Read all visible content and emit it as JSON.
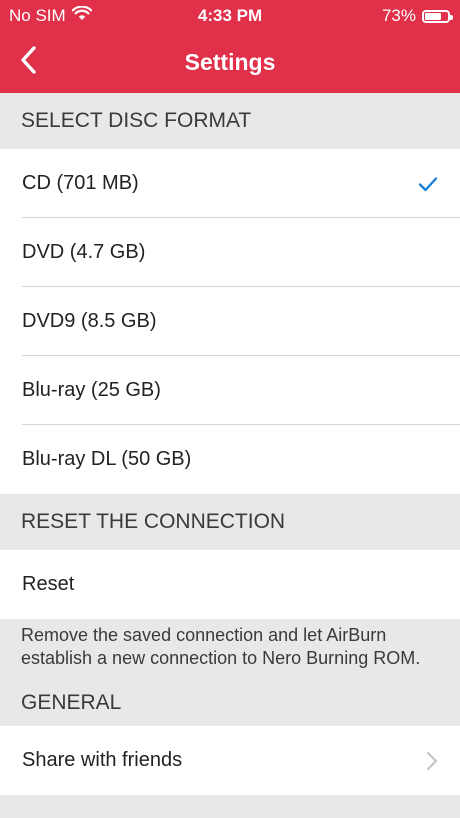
{
  "status": {
    "carrier": "No SIM",
    "time": "4:33 PM",
    "battery_percent": "73%",
    "battery_level": 0.73
  },
  "nav": {
    "title": "Settings",
    "back_icon": "chevron-left-icon"
  },
  "disc_format": {
    "header": "SELECT DISC FORMAT",
    "options": [
      {
        "label": "CD (701 MB)",
        "selected": true
      },
      {
        "label": "DVD (4.7 GB)",
        "selected": false
      },
      {
        "label": "DVD9 (8.5 GB)",
        "selected": false
      },
      {
        "label": "Blu-ray (25 GB)",
        "selected": false
      },
      {
        "label": "Blu-ray DL (50 GB)",
        "selected": false
      }
    ]
  },
  "reset": {
    "header": "RESET THE CONNECTION",
    "button_label": "Reset",
    "note": "Remove the saved connection and let AirBurn establish a new connection to Nero Burning ROM."
  },
  "general": {
    "header": "GENERAL",
    "share_label": "Share with friends"
  },
  "colors": {
    "accent": "#e0304a",
    "check": "#1a7fd6"
  }
}
